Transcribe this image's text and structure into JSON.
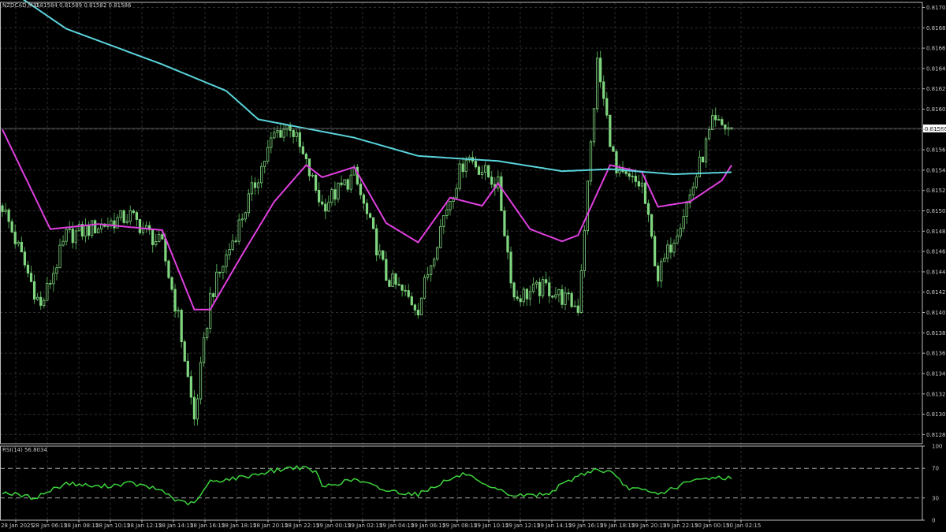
{
  "header": {
    "symbol": "NZDCAD,M15",
    "ohlc": "0.81584 0.81589 0.81582 0.81586"
  },
  "rsi_header": {
    "label": "RSI(14) 56.8034"
  },
  "current_price_label": "0.81586",
  "colors": {
    "background": "#000000",
    "grid": "#2e2e2e",
    "axis": "#c8c8c8",
    "candle": "#7fd67f",
    "candle_wick": "#4fa04f",
    "ma_fast": "#e040e0",
    "ma_slow": "#5ad4dc",
    "rsi_line": "#3cd23c",
    "rsi_levels": "#a0a0a0"
  },
  "chart_data": [
    {
      "type": "line",
      "panel": "price",
      "ylim": [
        0.81276,
        0.8171
      ],
      "y_ticks": [
        "0.81705",
        "0.81685",
        "0.81665",
        "0.81645",
        "0.81625",
        "0.81605",
        "0.81585",
        "0.81565",
        "0.81545",
        "0.81525",
        "0.81505",
        "0.81485",
        "0.81465",
        "0.81445",
        "0.81425",
        "0.81405",
        "0.81385",
        "0.81365",
        "0.81345",
        "0.81325",
        "0.81305",
        "0.81285"
      ],
      "x_ticks": [
        "28 Jan 2025",
        "28 Jan 06:15",
        "28 Jan 08:15",
        "28 Jan 10:15",
        "28 Jan 12:15",
        "28 Jan 14:15",
        "28 Jan 16:15",
        "28 Jan 18:15",
        "28 Jan 20:15",
        "28 Jan 22:15",
        "29 Jan 00:15",
        "29 Jan 02:15",
        "29 Jan 04:15",
        "29 Jan 06:15",
        "29 Jan 08:15",
        "29 Jan 10:15",
        "29 Jan 12:15",
        "29 Jan 14:15",
        "29 Jan 16:15",
        "29 Jan 18:15",
        "29 Jan 20:15",
        "29 Jan 22:15",
        "30 Jan 00:15",
        "30 Jan 02:15"
      ],
      "candles": {
        "count": 229,
        "anchors": [
          [
            0,
            0.8151
          ],
          [
            12,
            0.8141
          ],
          [
            20,
            0.8148
          ],
          [
            40,
            0.815
          ],
          [
            50,
            0.8147
          ],
          [
            55,
            0.814
          ],
          [
            60,
            0.813
          ],
          [
            65,
            0.8142
          ],
          [
            75,
            0.815
          ],
          [
            85,
            0.8158
          ],
          [
            90,
            0.8159
          ],
          [
            100,
            0.8151
          ],
          [
            110,
            0.8154
          ],
          [
            120,
            0.8144
          ],
          [
            130,
            0.8141
          ],
          [
            138,
            0.815
          ],
          [
            145,
            0.8156
          ],
          [
            155,
            0.8153
          ],
          [
            160,
            0.8142
          ],
          [
            170,
            0.8143
          ],
          [
            180,
            0.8141
          ],
          [
            186,
            0.8165
          ],
          [
            192,
            0.8154
          ],
          [
            200,
            0.8153
          ],
          [
            205,
            0.8144
          ],
          [
            215,
            0.8152
          ],
          [
            222,
            0.8159
          ],
          [
            228,
            0.81586
          ]
        ]
      },
      "series": [
        {
          "name": "",
          "points": [
            [
              0,
              0.81585
            ],
            [
              15,
              0.81487
            ],
            [
              30,
              0.81492
            ],
            [
              50,
              0.81486
            ],
            [
              60,
              0.81408
            ],
            [
              65,
              0.81408
            ],
            [
              75,
              0.81462
            ],
            [
              85,
              0.81514
            ],
            [
              95,
              0.8155
            ],
            [
              100,
              0.81538
            ],
            [
              110,
              0.81548
            ],
            [
              120,
              0.81493
            ],
            [
              130,
              0.81474
            ],
            [
              140,
              0.81518
            ],
            [
              150,
              0.8151
            ],
            [
              155,
              0.81532
            ],
            [
              165,
              0.81487
            ],
            [
              175,
              0.81475
            ],
            [
              180,
              0.81481
            ],
            [
              190,
              0.8155
            ],
            [
              200,
              0.81543
            ],
            [
              205,
              0.81509
            ],
            [
              215,
              0.81514
            ],
            [
              225,
              0.81535
            ],
            [
              228,
              0.8155
            ]
          ]
        },
        {
          "name": "",
          "points": [
            [
              0,
              0.81727
            ],
            [
              20,
              0.81684
            ],
            [
              50,
              0.81649
            ],
            [
              70,
              0.81623
            ],
            [
              80,
              0.81595
            ],
            [
              95,
              0.81586
            ],
            [
              110,
              0.81577
            ],
            [
              130,
              0.81559
            ],
            [
              155,
              0.81554
            ],
            [
              175,
              0.81544
            ],
            [
              190,
              0.81546
            ],
            [
              210,
              0.81541
            ],
            [
              228,
              0.81543
            ]
          ]
        }
      ]
    },
    {
      "type": "line",
      "panel": "indicator",
      "title": "RSI(14) 56.8034",
      "ylim": [
        0,
        100
      ],
      "levels": [
        70,
        30
      ],
      "y_ticks": [
        "100",
        "70",
        "30",
        "0"
      ],
      "series": [
        {
          "name": "",
          "points": [
            [
              0,
              38
            ],
            [
              10,
              30
            ],
            [
              20,
              50
            ],
            [
              30,
              45
            ],
            [
              40,
              50
            ],
            [
              50,
              40
            ],
            [
              55,
              25
            ],
            [
              60,
              22
            ],
            [
              65,
              52
            ],
            [
              75,
              58
            ],
            [
              85,
              67
            ],
            [
              92,
              72
            ],
            [
              98,
              66
            ],
            [
              100,
              45
            ],
            [
              110,
              55
            ],
            [
              120,
              40
            ],
            [
              130,
              35
            ],
            [
              138,
              52
            ],
            [
              145,
              63
            ],
            [
              150,
              47
            ],
            [
              160,
              33
            ],
            [
              170,
              35
            ],
            [
              180,
              60
            ],
            [
              185,
              68
            ],
            [
              190,
              65
            ],
            [
              195,
              45
            ],
            [
              205,
              35
            ],
            [
              215,
              52
            ],
            [
              222,
              58
            ],
            [
              228,
              57
            ]
          ]
        }
      ]
    }
  ]
}
